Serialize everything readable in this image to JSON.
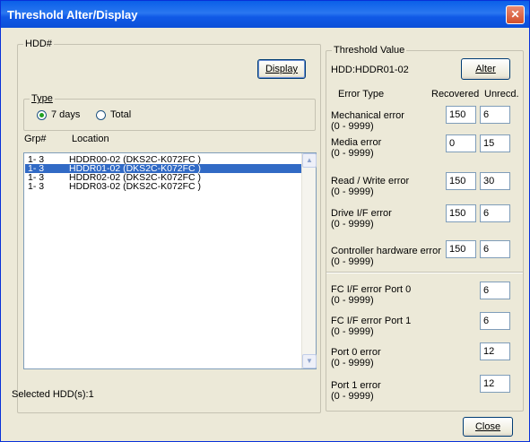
{
  "window": {
    "title": "Threshold Alter/Display",
    "close_glyph": "✕"
  },
  "hdd_panel": {
    "label": "HDD#",
    "display_button": "Display",
    "type_group": {
      "label": "Type",
      "options": [
        {
          "label": "7 days",
          "selected": true
        },
        {
          "label": "Total",
          "selected": false
        }
      ]
    },
    "columns": {
      "grp": "Grp#",
      "location": "Location"
    },
    "rows": [
      {
        "grp": "1- 3",
        "location": "HDDR00-02 (DKS2C-K072FC     )"
      },
      {
        "grp": "1- 3",
        "location": "HDDR01-02 (DKS2C-K072FC     )",
        "selected": true
      },
      {
        "grp": "1- 3",
        "location": "HDDR02-02 (DKS2C-K072FC     )"
      },
      {
        "grp": "1- 3",
        "location": "HDDR03-02 (DKS2C-K072FC     )"
      }
    ],
    "selected_count_text": "Selected HDD(s):1"
  },
  "threshold": {
    "label": "Threshold Value",
    "hdd_text": "HDD:HDDR01-02",
    "alter_button": "Alter",
    "col_error_type": "Error Type",
    "col_recovered": "Recovered",
    "col_unrecd": "Unrecd.",
    "errors": [
      {
        "label": "Mechanical error",
        "range": "(0 - 9999)",
        "recovered": "150",
        "unrecd": "6"
      },
      {
        "label": "Media error",
        "range": "(0 - 9999)",
        "recovered": "0",
        "unrecd": "15"
      },
      {
        "label": "Read / Write error",
        "range": "(0 - 9999)",
        "recovered": "150",
        "unrecd": "30"
      },
      {
        "label": "Drive I/F error",
        "range": "(0 - 9999)",
        "recovered": "150",
        "unrecd": "6"
      },
      {
        "label": "Controller hardware error",
        "range": "(0 - 9999)",
        "recovered": "150",
        "unrecd": "6"
      }
    ],
    "port_errors": [
      {
        "label": "FC I/F error Port 0",
        "range": "(0 - 9999)",
        "unrecd": "6"
      },
      {
        "label": "FC I/F error Port 1",
        "range": "(0 - 9999)",
        "unrecd": "6"
      },
      {
        "label": "Port 0 error",
        "range": "(0 - 9999)",
        "unrecd": "12"
      },
      {
        "label": "Port 1 error",
        "range": "(0 - 9999)",
        "unrecd": "12"
      }
    ]
  },
  "footer": {
    "close_button": "Close"
  }
}
